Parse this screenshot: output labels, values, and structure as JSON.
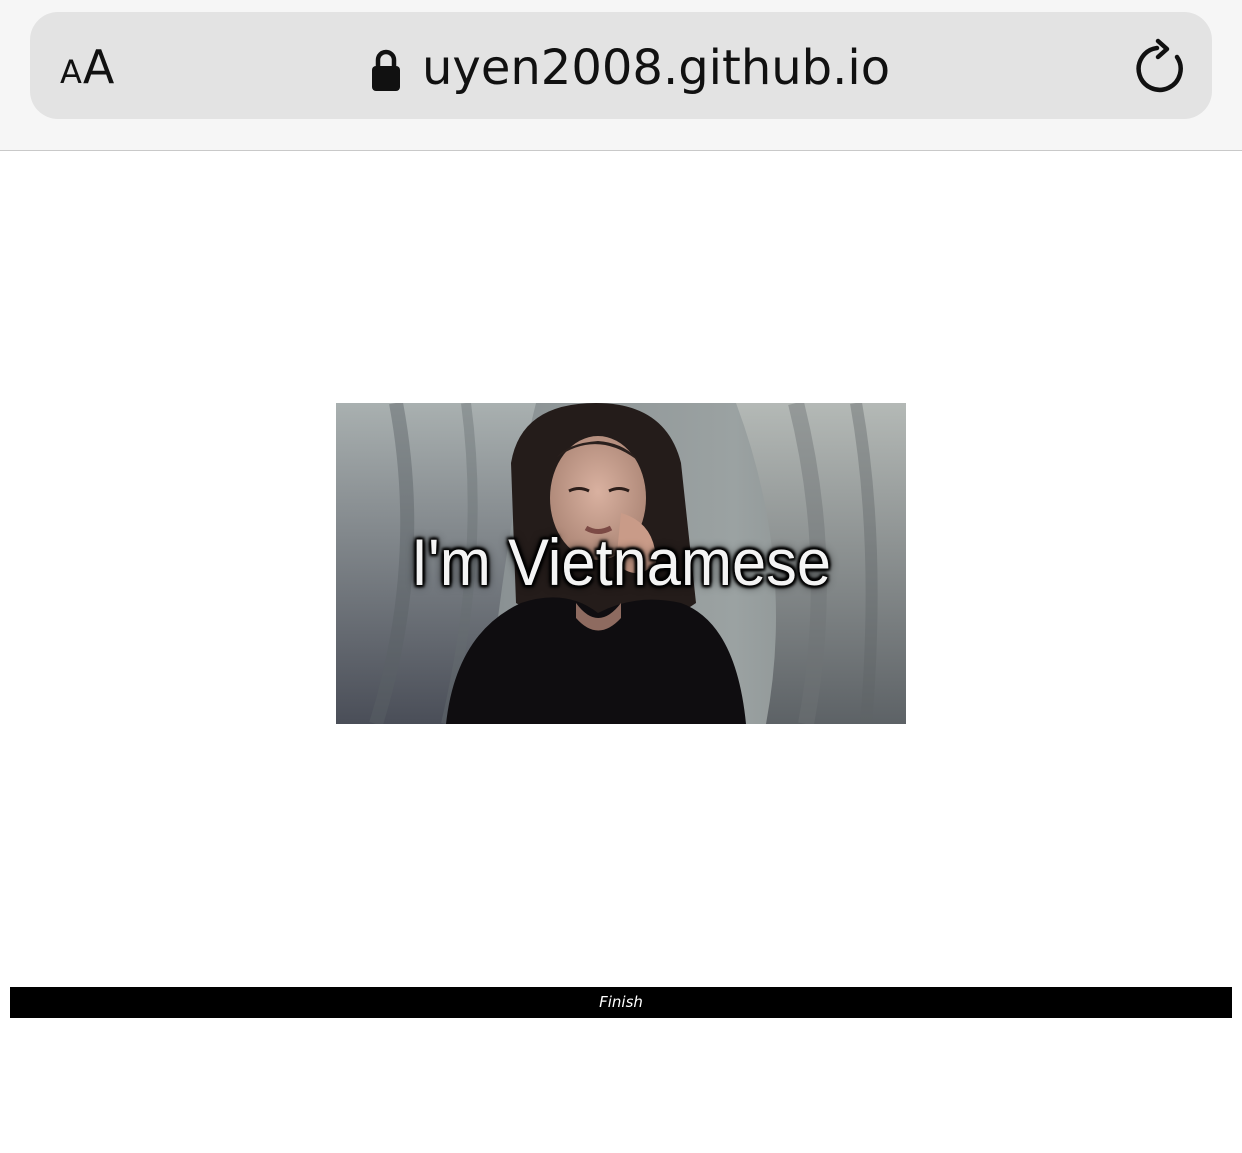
{
  "browser": {
    "text_size_small": "A",
    "text_size_large": "A",
    "url": "uyen2008.github.io",
    "icons": {
      "lock": "lock-icon",
      "reload": "reload-icon"
    }
  },
  "page": {
    "hero_caption": "I'm Vietnamese",
    "finish_label": "Finish"
  },
  "colors": {
    "chrome_background": "#f6f6f6",
    "address_bar": "#e3e3e3",
    "finish_button_bg": "#000000",
    "finish_button_text": "#ffffff"
  }
}
